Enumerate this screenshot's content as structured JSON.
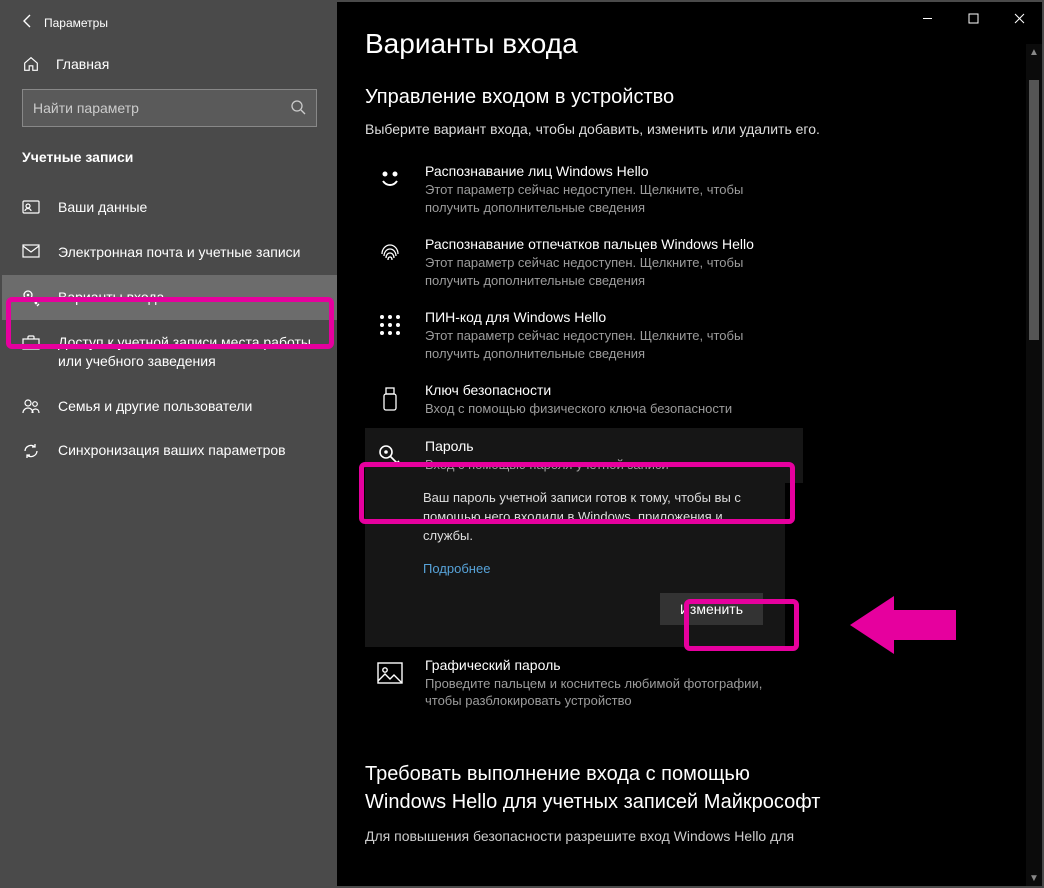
{
  "window": {
    "title": "Параметры"
  },
  "sidebar": {
    "home": "Главная",
    "search_placeholder": "Найти параметр",
    "section": "Учетные записи",
    "items": [
      {
        "label": "Ваши данные"
      },
      {
        "label": "Электронная почта и учетные записи"
      },
      {
        "label": "Варианты входа"
      },
      {
        "label": "Доступ к учетной записи места работы или учебного заведения"
      },
      {
        "label": "Семья и другие пользователи"
      },
      {
        "label": "Синхронизация ваших параметров"
      }
    ]
  },
  "main": {
    "heading": "Варианты входа",
    "section1": {
      "title": "Управление входом в устройство",
      "intro": "Выберите вариант входа, чтобы добавить, изменить или удалить его."
    },
    "options": [
      {
        "title": "Распознавание лиц Windows Hello",
        "sub": "Этот параметр сейчас недоступен. Щелкните, чтобы получить дополнительные сведения"
      },
      {
        "title": "Распознавание отпечатков пальцев Windows Hello",
        "sub": "Этот параметр сейчас недоступен. Щелкните, чтобы получить дополнительные сведения"
      },
      {
        "title": "ПИН-код для Windows Hello",
        "sub": "Этот параметр сейчас недоступен. Щелкните, чтобы получить дополнительные сведения"
      },
      {
        "title": "Ключ безопасности",
        "sub": "Вход с помощью физического ключа безопасности"
      },
      {
        "title": "Пароль",
        "sub": "Вход с помощью пароля учетной записи"
      },
      {
        "title": "Графический пароль",
        "sub": "Проведите пальцем и коснитесь любимой фотографии, чтобы разблокировать устройство"
      }
    ],
    "password_panel": {
      "text": "Ваш пароль учетной записи готов к тому, чтобы вы с помощью него входили в Windows, приложения и службы.",
      "link": "Подробнее",
      "button": "Изменить"
    },
    "section2": {
      "title": "Требовать выполнение входа с помощью Windows Hello для учетных записей Майкрософт",
      "desc": "Для повышения безопасности разрешите вход Windows Hello для"
    }
  }
}
